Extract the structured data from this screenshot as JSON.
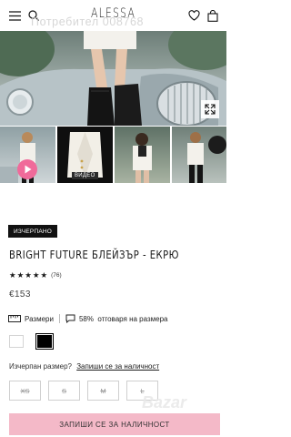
{
  "header": {
    "brand": "ALESSA",
    "menu_icon": "hamburger-icon",
    "search_icon": "search-icon",
    "wishlist_icon": "heart-icon",
    "cart_icon": "bag-icon"
  },
  "watermark": "Потребител 008768",
  "gallery": {
    "expand_icon": "expand-icon",
    "video_label": "ВИДЕО",
    "play_icon": "play-icon"
  },
  "product": {
    "badge": "ИЗЧЕРПАНО",
    "title": "BRIGHT FUTURE БЛЕЙЗЪР - ЕКРЮ",
    "rating": 5,
    "review_count": "(76)",
    "price": "€153"
  },
  "meta": {
    "sizes_label": "Размери",
    "fit_text": "58%  отговаря на размера"
  },
  "colors": [
    {
      "name": "ecru",
      "hex": "#ffffff"
    },
    {
      "name": "black",
      "hex": "#000000"
    }
  ],
  "notify": {
    "question": "Изчерпан размер?",
    "link": "Запиши се за наличност"
  },
  "sizes": [
    "XS",
    "S",
    "M",
    "L"
  ],
  "cta": "ЗАПИШИ СЕ ЗА НАЛИЧНОСТ",
  "site_mark": "Bazar",
  "accent_colors": {
    "cta": "#f4b9c8",
    "badge": "#111111"
  }
}
